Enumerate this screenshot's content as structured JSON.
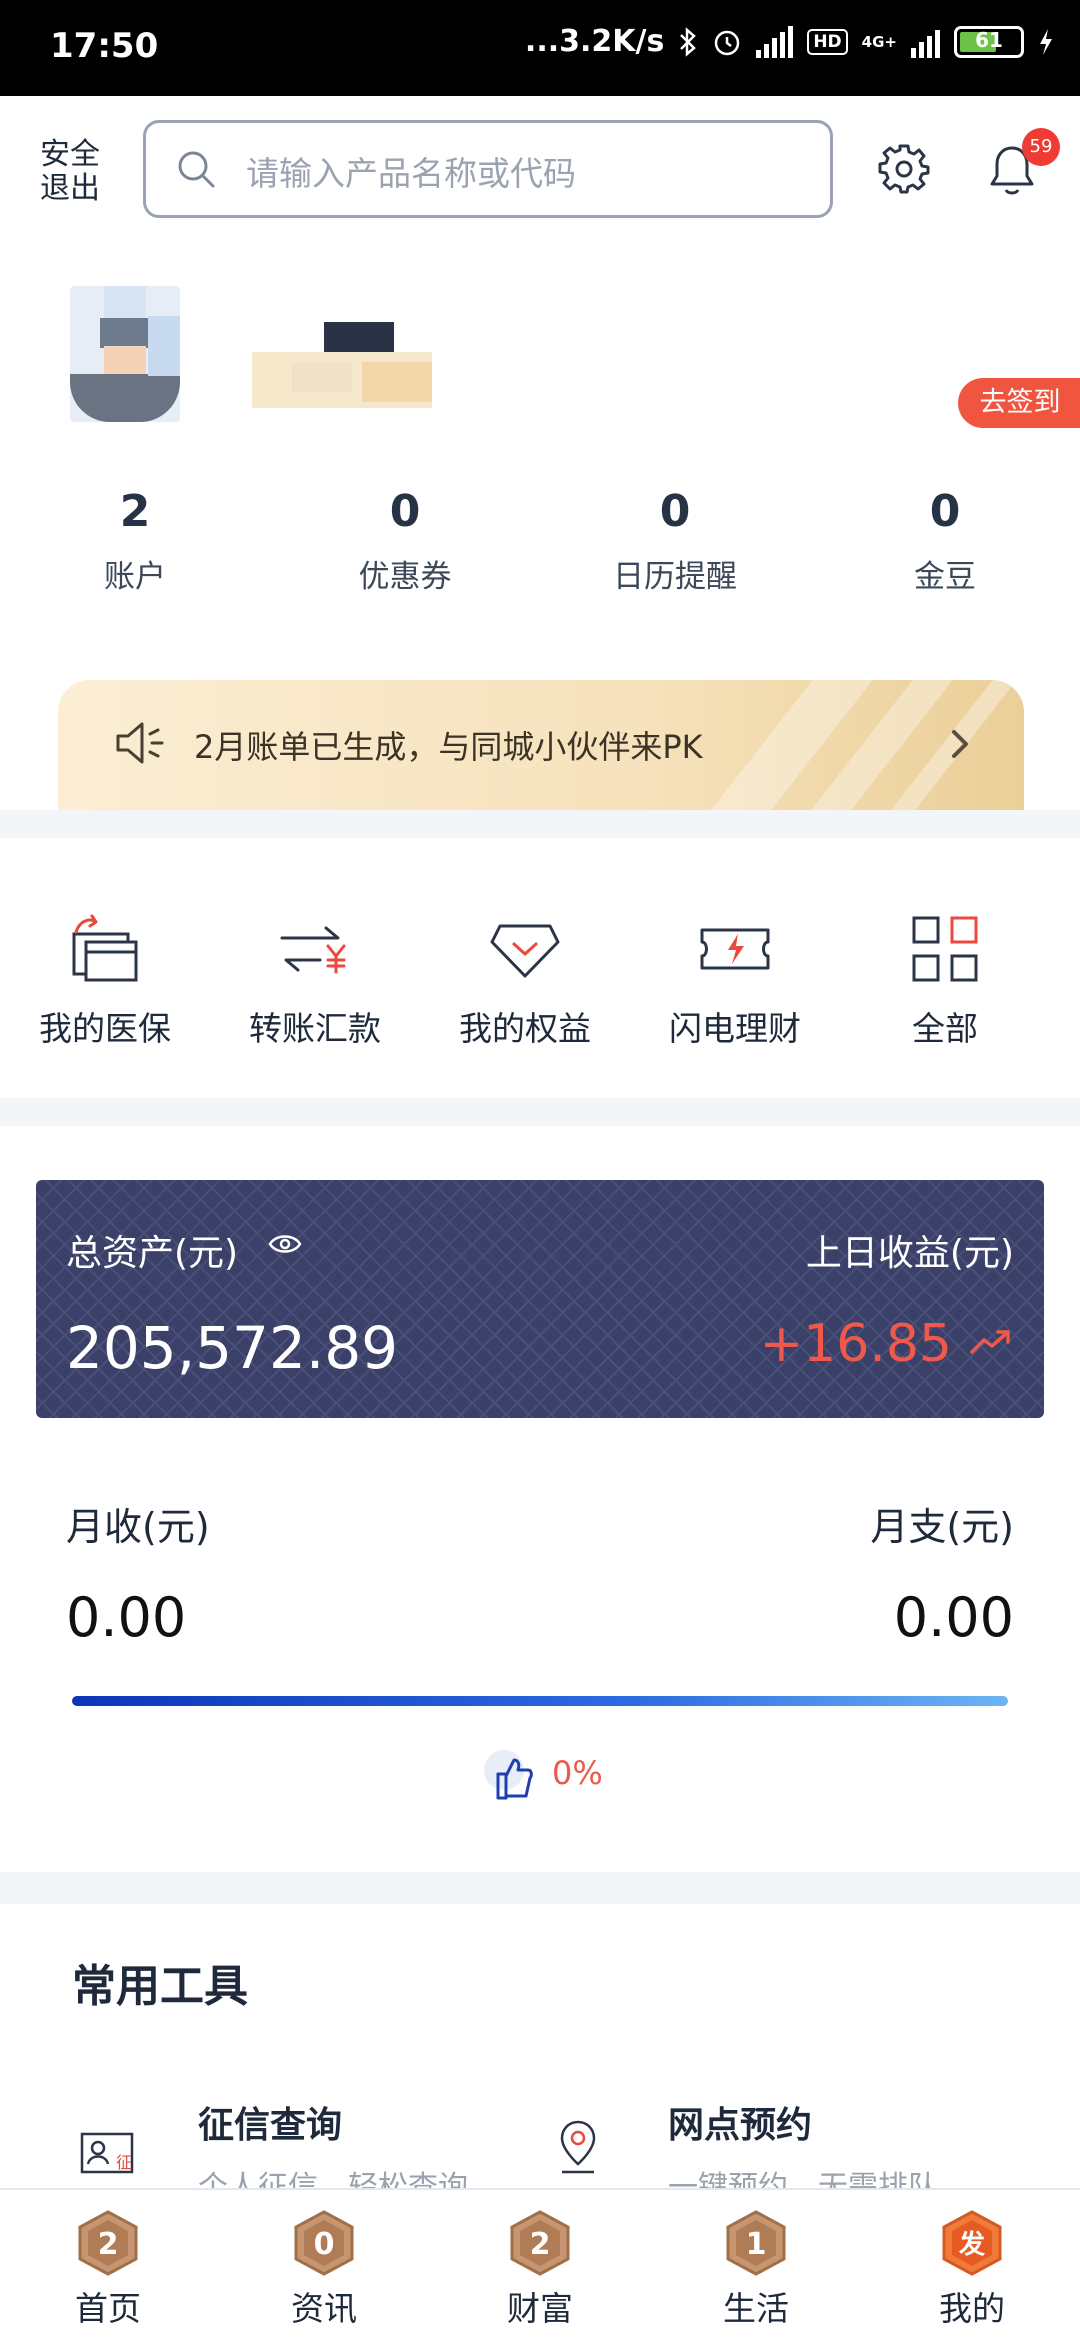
{
  "status_bar": {
    "time": "17:50",
    "network_speed": "...3.2K/s",
    "hd_label": "HD",
    "net_type": "4G+",
    "battery": "61"
  },
  "header": {
    "logout_label": "安全退出",
    "search_placeholder": "请输入产品名称或代码",
    "notification_count": "59",
    "signin_label": "去签到"
  },
  "stats": [
    {
      "value": "2",
      "label": "账户"
    },
    {
      "value": "0",
      "label": "优惠券"
    },
    {
      "value": "0",
      "label": "日历提醒"
    },
    {
      "value": "0",
      "label": "金豆"
    }
  ],
  "promo": {
    "text": "2月账单已生成，与同城小伙伴来PK"
  },
  "quick_actions": [
    {
      "label": "我的医保",
      "icon": "medical-card-icon"
    },
    {
      "label": "转账汇款",
      "icon": "transfer-icon"
    },
    {
      "label": "我的权益",
      "icon": "diamond-icon"
    },
    {
      "label": "闪电理财",
      "icon": "lightning-ticket-icon"
    },
    {
      "label": "全部",
      "icon": "grid-icon"
    }
  ],
  "assets": {
    "total_label": "总资产(元)",
    "total_value": "205,572.89",
    "yesterday_label": "上日收益(元)",
    "yesterday_value": "+16.85",
    "month_income_label": "月收(元)",
    "month_income_value": "0.00",
    "month_expense_label": "月支(元)",
    "month_expense_value": "0.00",
    "percent": "0%",
    "card_color": "#3a4068",
    "gain_color": "#f0584a"
  },
  "tools": {
    "title": "常用工具",
    "items": [
      {
        "name": "征信查询",
        "desc": "个人征信，轻松查询",
        "icon": "credit-report-icon"
      },
      {
        "name": "网点预约",
        "desc": "一键预约，无需排队",
        "icon": "location-pin-icon"
      }
    ]
  },
  "tabbar": [
    {
      "label": "首页",
      "glyph": "2"
    },
    {
      "label": "资讯",
      "glyph": "0"
    },
    {
      "label": "财富",
      "glyph": "2"
    },
    {
      "label": "生活",
      "glyph": "1"
    },
    {
      "label": "我的",
      "glyph": "发"
    }
  ]
}
